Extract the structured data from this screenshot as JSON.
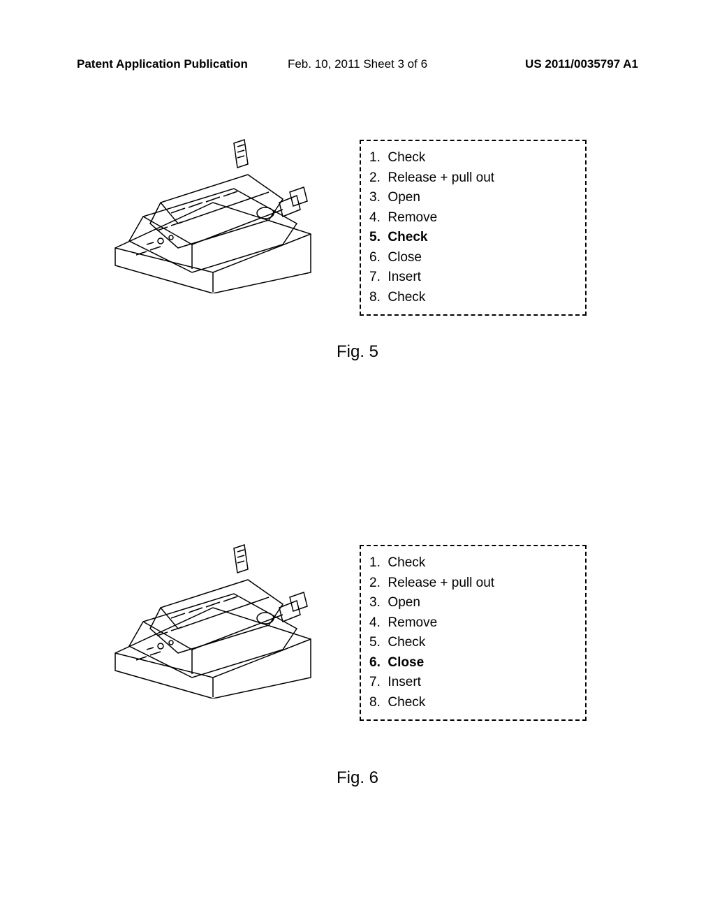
{
  "header": {
    "left": "Patent Application Publication",
    "center": "Feb. 10, 2011  Sheet 3 of 6",
    "right": "US 2011/0035797 A1"
  },
  "figure1": {
    "caption": "Fig. 5",
    "steps": [
      {
        "num": "1.",
        "text": "Check",
        "bold": false
      },
      {
        "num": "2.",
        "text": "Release + pull out",
        "bold": false
      },
      {
        "num": "3.",
        "text": "Open",
        "bold": false
      },
      {
        "num": "4.",
        "text": "Remove",
        "bold": false
      },
      {
        "num": "5.",
        "text": "Check",
        "bold": true
      },
      {
        "num": "6.",
        "text": "Close",
        "bold": false
      },
      {
        "num": "7.",
        "text": "Insert",
        "bold": false
      },
      {
        "num": "8.",
        "text": "Check",
        "bold": false
      }
    ]
  },
  "figure2": {
    "caption": "Fig. 6",
    "steps": [
      {
        "num": "1.",
        "text": "Check",
        "bold": false
      },
      {
        "num": "2.",
        "text": "Release + pull out",
        "bold": false
      },
      {
        "num": "3.",
        "text": "Open",
        "bold": false
      },
      {
        "num": "4.",
        "text": "Remove",
        "bold": false
      },
      {
        "num": "5.",
        "text": "Check",
        "bold": false
      },
      {
        "num": "6.",
        "text": "Close",
        "bold": true
      },
      {
        "num": "7.",
        "text": "Insert",
        "bold": false
      },
      {
        "num": "8.",
        "text": "Check",
        "bold": false
      }
    ]
  }
}
